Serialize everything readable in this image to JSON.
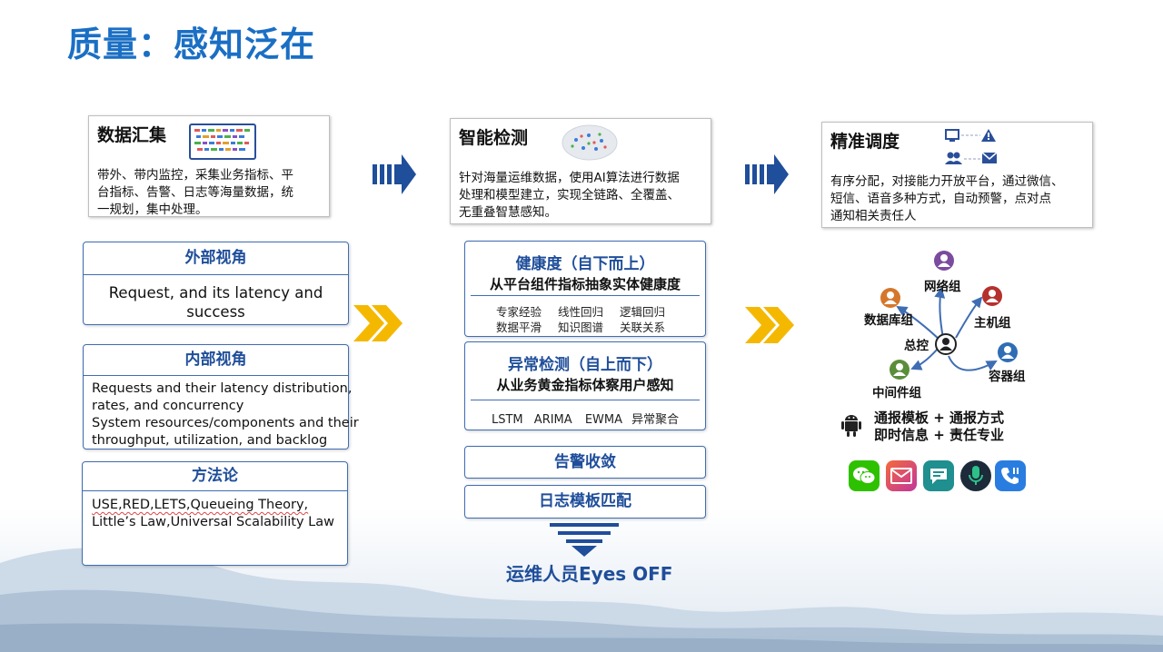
{
  "title": "质量：感知泛在",
  "collection": {
    "title": "数据汇集",
    "text": [
      "带外、带内监控，采集业务指标、平",
      "台指标、告警、日志等海量数据，统",
      "一规划，集中处理。"
    ]
  },
  "detection": {
    "title": "智能检测",
    "text": [
      "针对海量运维数据，使用AI算法进行数据",
      "处理和模型建立，实现全链路、全覆盖、",
      "无重叠智慧感知。"
    ]
  },
  "dispatch": {
    "title": "精准调度",
    "text": [
      "有序分配，对接能力开放平台，通过微信、",
      "短信、语音多种方式，自动预警，点对点",
      "通知相关责任人"
    ]
  },
  "external": {
    "title": "外部视角",
    "text": [
      "Request, and its latency and",
      "success"
    ]
  },
  "internal": {
    "title": "内部视角",
    "text": [
      "Requests and their latency distribution,",
      "rates, and concurrency",
      "System resources/components and their",
      "throughput, utilization, and backlog"
    ]
  },
  "methodology": {
    "title": "方法论",
    "text": [
      "USE,RED,LETS,Queueing Theory,",
      "Little’s Law,Universal Scalability Law"
    ]
  },
  "health": {
    "title": "健康度（自下而上）",
    "subtitle": "从平台组件指标抽象实体健康度",
    "row1": [
      "专家经验",
      "线性回归",
      "逻辑回归"
    ],
    "row2": [
      "数据平滑",
      "知识图谱",
      "关联关系"
    ]
  },
  "anomaly": {
    "title": "异常检测（自上而下）",
    "subtitle": "从业务黄金指标体察用户感知",
    "methods": [
      "LSTM",
      "ARIMA",
      "EWMA",
      "异常聚合"
    ]
  },
  "alarm": {
    "title": "告警收敛"
  },
  "logtpl": {
    "title": "日志模板匹配"
  },
  "eyes_off": "运维人员Eyes OFF",
  "network": {
    "center": "总控",
    "nodes": [
      "网络组",
      "数据库组",
      "主机组",
      "容器组",
      "中间件组"
    ]
  },
  "notify": {
    "line1": "通报模板 + 通报方式",
    "line2": "即时信息 + 责任专业"
  },
  "colors": {
    "title": "#1a6fc4",
    "box_border": "#3f6db3",
    "box_title": "#1f4e9a",
    "arrow_blue": "#1f4e9a",
    "chevron_yellow": "#f5b800",
    "node_network": "#7b4b9e",
    "node_db": "#d5772b",
    "node_host": "#b5312d",
    "node_container": "#2f6db5",
    "node_middleware": "#5a8e3a",
    "node_center": "#222222"
  }
}
